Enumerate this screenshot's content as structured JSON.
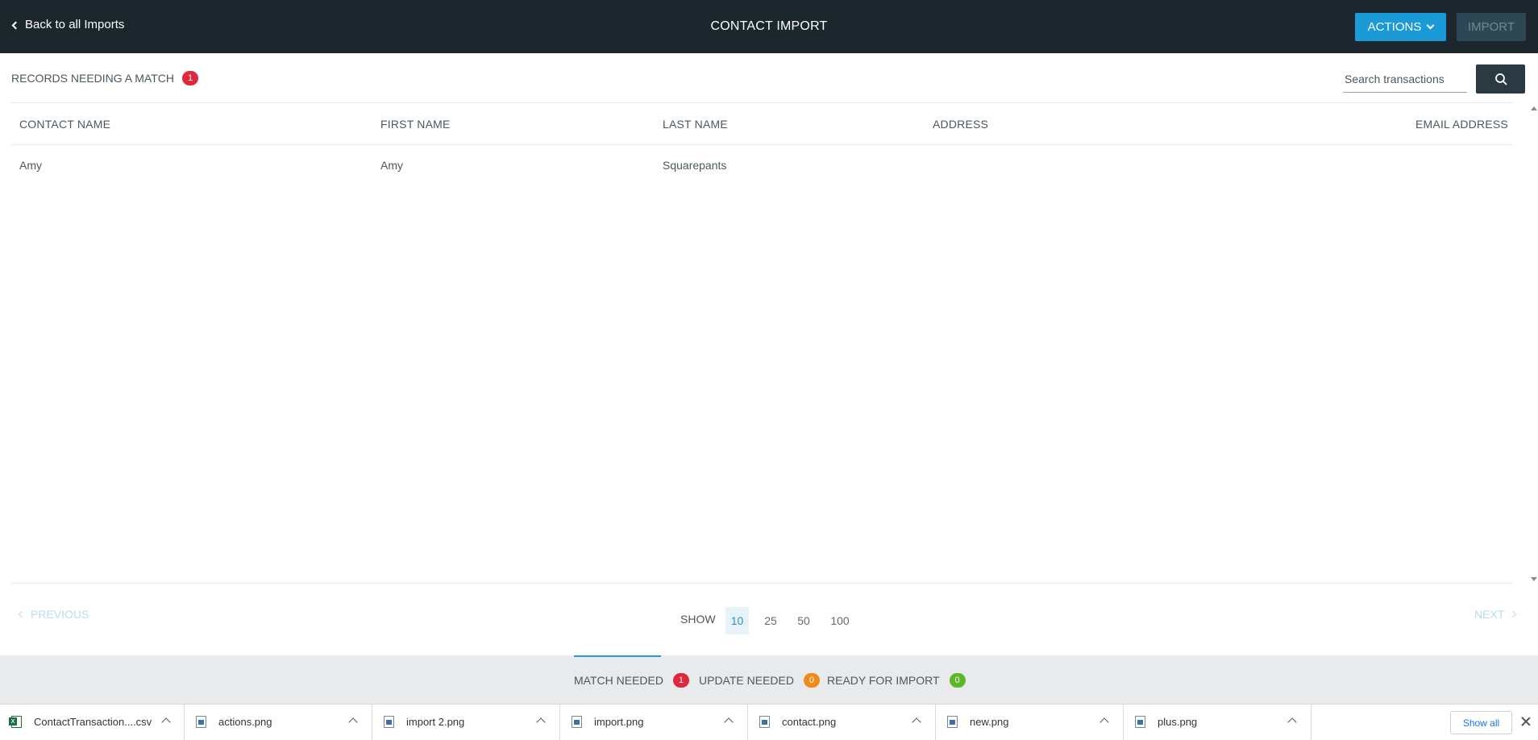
{
  "header": {
    "back_label": "Back to all Imports",
    "title": "CONTACT IMPORT",
    "actions_label": "ACTIONS",
    "import_label": "IMPORT"
  },
  "records": {
    "title": "RECORDS NEEDING A MATCH",
    "count": "1"
  },
  "search": {
    "placeholder": "Search transactions"
  },
  "table": {
    "columns": [
      "CONTACT NAME",
      "FIRST NAME",
      "LAST NAME",
      "ADDRESS",
      "EMAIL ADDRESS"
    ],
    "rows": [
      [
        "Amy",
        "Amy",
        "Squarepants",
        "",
        ""
      ]
    ]
  },
  "pagination": {
    "previous_label": "PREVIOUS",
    "next_label": "NEXT",
    "show_label": "SHOW",
    "sizes": [
      "10",
      "25",
      "50",
      "100"
    ],
    "selected_size": "10"
  },
  "tabs": [
    {
      "label": "MATCH NEEDED",
      "count": "1",
      "color": "#e0283c"
    },
    {
      "label": "UPDATE NEEDED",
      "count": "0",
      "color": "#ef8b1b"
    },
    {
      "label": "READY FOR IMPORT",
      "count": "0",
      "color": "#5cb82a"
    }
  ],
  "downloads": {
    "items": [
      {
        "name": "ContactTransaction....csv",
        "icon": "csv-file-icon"
      },
      {
        "name": "actions.png",
        "icon": "image-file-icon"
      },
      {
        "name": "import 2.png",
        "icon": "image-file-icon"
      },
      {
        "name": "import.png",
        "icon": "image-file-icon"
      },
      {
        "name": "contact.png",
        "icon": "image-file-icon"
      },
      {
        "name": "new.png",
        "icon": "image-file-icon"
      },
      {
        "name": "plus.png",
        "icon": "image-file-icon"
      }
    ],
    "show_all_label": "Show all"
  },
  "colors": {
    "header_bg": "#1b262d",
    "accent": "#1a9ad6",
    "badge_red": "#e0283c",
    "badge_orange": "#ef8b1b",
    "badge_green": "#5cb82a"
  }
}
